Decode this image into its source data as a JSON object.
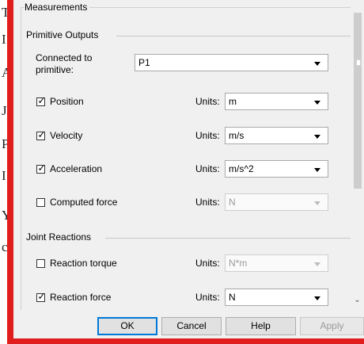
{
  "background_glyphs": [
    "T",
    "I",
    "A",
    "J",
    "P",
    "I",
    "Y",
    "c"
  ],
  "dialog": {
    "measurements_label": "Measurements",
    "primitive_outputs": {
      "title": "Primitive Outputs",
      "connected_label_line1": "Connected to",
      "connected_label_line2": "primitive:",
      "connected_value": "P1",
      "rows": [
        {
          "label": "Position",
          "checked": true,
          "units_label": "Units:",
          "unit": "m",
          "enabled": true
        },
        {
          "label": "Velocity",
          "checked": true,
          "units_label": "Units:",
          "unit": "m/s",
          "enabled": true
        },
        {
          "label": "Acceleration",
          "checked": true,
          "units_label": "Units:",
          "unit": "m/s^2",
          "enabled": true
        },
        {
          "label": "Computed force",
          "checked": false,
          "units_label": "Units:",
          "unit": "N",
          "enabled": false
        }
      ]
    },
    "joint_reactions": {
      "title": "Joint Reactions",
      "rows": [
        {
          "label": "Reaction torque",
          "checked": false,
          "units_label": "Units:",
          "unit": "N*m",
          "enabled": false
        },
        {
          "label": "Reaction force",
          "checked": true,
          "units_label": "Units:",
          "unit": "N",
          "enabled": true
        }
      ]
    },
    "buttons": {
      "ok": "OK",
      "cancel": "Cancel",
      "help": "Help",
      "apply": "Apply"
    },
    "check_glyph": "✓",
    "scroll_down_glyph": "⌄"
  },
  "colors": {
    "frame": "#e01e1e",
    "default_button_border": "#0078d7"
  }
}
